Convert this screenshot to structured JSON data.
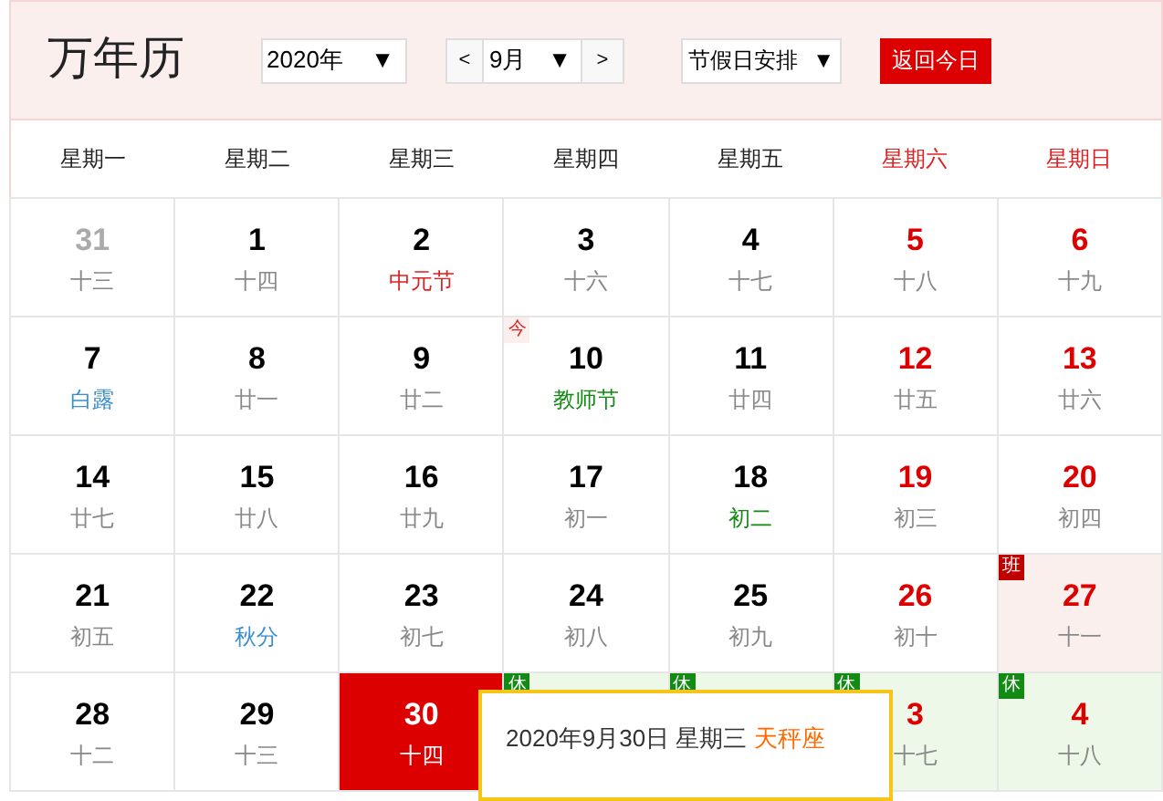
{
  "title": "万年历",
  "controls": {
    "year": "2020年",
    "prev": "<",
    "month": "9月",
    "next": ">",
    "holiday_select": "节假日安排",
    "dropdown_arrow": "▼",
    "today_button": "返回今日"
  },
  "weekdays": [
    {
      "label": "星期一",
      "weekend": false
    },
    {
      "label": "星期二",
      "weekend": false
    },
    {
      "label": "星期三",
      "weekend": false
    },
    {
      "label": "星期四",
      "weekend": false
    },
    {
      "label": "星期五",
      "weekend": false
    },
    {
      "label": "星期六",
      "weekend": true
    },
    {
      "label": "星期日",
      "weekend": true
    }
  ],
  "days": [
    {
      "day": "31",
      "lunar": {
        "text": "十三",
        "kind": "normal"
      },
      "kind": "other_month"
    },
    {
      "day": "1",
      "lunar": {
        "text": "十四",
        "kind": "normal"
      },
      "kind": "normal",
      "weekend": false
    },
    {
      "day": "2",
      "lunar": {
        "text": "中元节",
        "kind": "holiday"
      },
      "kind": "normal",
      "weekend": false
    },
    {
      "day": "3",
      "lunar": {
        "text": "十六",
        "kind": "normal"
      },
      "kind": "normal",
      "weekend": false
    },
    {
      "day": "4",
      "lunar": {
        "text": "十七",
        "kind": "normal"
      },
      "kind": "normal",
      "weekend": false
    },
    {
      "day": "5",
      "lunar": {
        "text": "十八",
        "kind": "normal"
      },
      "kind": "normal",
      "weekend": true
    },
    {
      "day": "6",
      "lunar": {
        "text": "十九",
        "kind": "normal"
      },
      "kind": "normal",
      "weekend": true
    },
    {
      "day": "7",
      "lunar": {
        "text": "白露",
        "kind": "term"
      },
      "kind": "normal",
      "weekend": false
    },
    {
      "day": "8",
      "lunar": {
        "text": "廿一",
        "kind": "normal"
      },
      "kind": "normal",
      "weekend": false
    },
    {
      "day": "9",
      "lunar": {
        "text": "廿二",
        "kind": "normal"
      },
      "kind": "normal",
      "weekend": false
    },
    {
      "day": "10",
      "lunar": {
        "text": "教师节",
        "kind": "festival"
      },
      "kind": "normal",
      "weekend": false,
      "badge": {
        "kind": "today",
        "text": "今"
      }
    },
    {
      "day": "11",
      "lunar": {
        "text": "廿四",
        "kind": "normal"
      },
      "kind": "normal",
      "weekend": false
    },
    {
      "day": "12",
      "lunar": {
        "text": "廿五",
        "kind": "normal"
      },
      "kind": "normal",
      "weekend": true
    },
    {
      "day": "13",
      "lunar": {
        "text": "廿六",
        "kind": "normal"
      },
      "kind": "normal",
      "weekend": true
    },
    {
      "day": "14",
      "lunar": {
        "text": "廿七",
        "kind": "normal"
      },
      "kind": "normal",
      "weekend": false
    },
    {
      "day": "15",
      "lunar": {
        "text": "廿八",
        "kind": "normal"
      },
      "kind": "normal",
      "weekend": false
    },
    {
      "day": "16",
      "lunar": {
        "text": "廿九",
        "kind": "normal"
      },
      "kind": "normal",
      "weekend": false
    },
    {
      "day": "17",
      "lunar": {
        "text": "初一",
        "kind": "normal"
      },
      "kind": "normal",
      "weekend": false
    },
    {
      "day": "18",
      "lunar": {
        "text": "初二",
        "kind": "festival"
      },
      "kind": "normal",
      "weekend": false
    },
    {
      "day": "19",
      "lunar": {
        "text": "初三",
        "kind": "normal"
      },
      "kind": "normal",
      "weekend": true
    },
    {
      "day": "20",
      "lunar": {
        "text": "初四",
        "kind": "normal"
      },
      "kind": "normal",
      "weekend": true
    },
    {
      "day": "21",
      "lunar": {
        "text": "初五",
        "kind": "normal"
      },
      "kind": "normal",
      "weekend": false
    },
    {
      "day": "22",
      "lunar": {
        "text": "秋分",
        "kind": "term"
      },
      "kind": "normal",
      "weekend": false
    },
    {
      "day": "23",
      "lunar": {
        "text": "初七",
        "kind": "normal"
      },
      "kind": "normal",
      "weekend": false
    },
    {
      "day": "24",
      "lunar": {
        "text": "初八",
        "kind": "normal"
      },
      "kind": "normal",
      "weekend": false
    },
    {
      "day": "25",
      "lunar": {
        "text": "初九",
        "kind": "normal"
      },
      "kind": "normal",
      "weekend": false
    },
    {
      "day": "26",
      "lunar": {
        "text": "初十",
        "kind": "normal"
      },
      "kind": "normal",
      "weekend": true
    },
    {
      "day": "27",
      "lunar": {
        "text": "十一",
        "kind": "normal"
      },
      "kind": "workday",
      "weekend": true,
      "badge": {
        "kind": "work",
        "text": "班"
      }
    },
    {
      "day": "28",
      "lunar": {
        "text": "十二",
        "kind": "normal"
      },
      "kind": "normal",
      "weekend": false
    },
    {
      "day": "29",
      "lunar": {
        "text": "十三",
        "kind": "normal"
      },
      "kind": "normal",
      "weekend": false
    },
    {
      "day": "30",
      "lunar": {
        "text": "十四"
      },
      "kind": "selected"
    },
    {
      "kind": "holiday",
      "badge": {
        "kind": "rest",
        "text": "休"
      }
    },
    {
      "kind": "holiday",
      "badge": {
        "kind": "rest",
        "text": "休"
      }
    },
    {
      "day": "3",
      "lunar": {
        "text": "十七",
        "kind": "normal"
      },
      "kind": "holiday",
      "weekend": true,
      "badge": {
        "kind": "rest",
        "text": "休"
      }
    },
    {
      "day": "4",
      "lunar": {
        "text": "十八",
        "kind": "normal"
      },
      "kind": "holiday",
      "weekend": true,
      "badge": {
        "kind": "rest",
        "text": "休"
      }
    }
  ],
  "tooltip": {
    "date": "2020年9月30日 星期三",
    "constellation": "天秤座"
  }
}
